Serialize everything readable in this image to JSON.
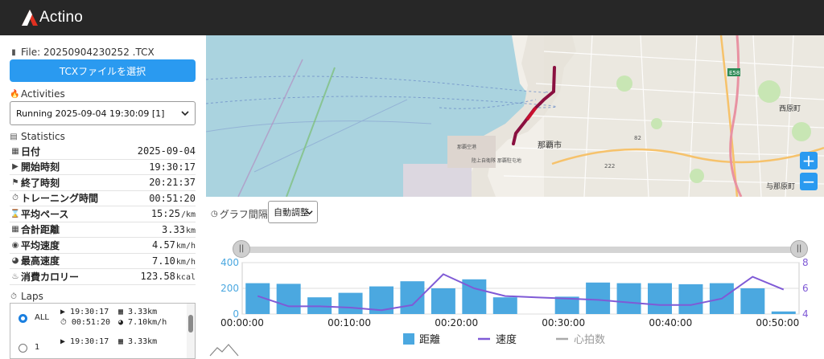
{
  "app": {
    "logo_text": "Actino"
  },
  "file": {
    "label": "File: 20250904230252 .TCX",
    "select_button": "TCXファイルを選択"
  },
  "activities": {
    "title": "Activities",
    "selected": "Running 2025-09-04 19:30:09 [1]"
  },
  "statistics": {
    "title": "Statistics",
    "rows": [
      {
        "icon": "calendar-icon",
        "label": "日付",
        "value": "2025-09-04",
        "unit": ""
      },
      {
        "icon": "play-icon",
        "label": "開始時刻",
        "value": "19:30:17",
        "unit": ""
      },
      {
        "icon": "flag-icon",
        "label": "終了時刻",
        "value": "20:21:37",
        "unit": ""
      },
      {
        "icon": "stopwatch-icon",
        "label": "トレーニング時間",
        "value": "00:51:20",
        "unit": ""
      },
      {
        "icon": "hourglass-icon",
        "label": "平均ペース",
        "value": "15:25",
        "unit": "/km"
      },
      {
        "icon": "map-icon",
        "label": "合計距離",
        "value": "3.33",
        "unit": "km"
      },
      {
        "icon": "gauge-icon",
        "label": "平均速度",
        "value": "4.57",
        "unit": "km/h"
      },
      {
        "icon": "speedometer-icon",
        "label": "最高速度",
        "value": "7.10",
        "unit": "km/h"
      },
      {
        "icon": "flame-icon",
        "label": "消費カロリー",
        "value": "123.58",
        "unit": "kcal"
      }
    ]
  },
  "laps": {
    "title": "Laps",
    "items": [
      {
        "name": "ALL",
        "start": "19:30:17",
        "duration": "00:51:20",
        "distance": "3.33km",
        "speed": "7.10km/h",
        "selected": true
      },
      {
        "name": "1",
        "start": "19:30:17",
        "duration": "",
        "distance": "3.33km",
        "speed": "",
        "selected": false
      }
    ]
  },
  "map": {
    "labels": {
      "city": "那覇市",
      "town1": "西原町",
      "town2": "与那原町",
      "route1": "那覇空港",
      "route2": "陸上自衛隊 那覇駐屯地",
      "route_sign": "E58",
      "road": "222",
      "road2": "82"
    },
    "zoom_in": "+",
    "zoom_out": "−"
  },
  "graph": {
    "interval_label": "グラフ間隔",
    "interval_value": "自動調整"
  },
  "chart_data": {
    "type": "bar",
    "x_ticks": [
      "00:00:00",
      "00:10:00",
      "00:20:00",
      "00:30:00",
      "00:40:00",
      "00:50:00"
    ],
    "y_left": {
      "ticks": [
        "0",
        "200",
        "400"
      ],
      "range": [
        0,
        400
      ]
    },
    "y_right": {
      "ticks": [
        "4",
        "6",
        "8"
      ],
      "range": [
        4,
        8
      ]
    },
    "series": [
      {
        "name": "距離",
        "kind": "bar",
        "color": "#4ba8e0",
        "values": [
          240,
          235,
          130,
          165,
          215,
          255,
          200,
          270,
          130,
          0,
          135,
          245,
          240,
          240,
          232,
          240,
          200,
          20
        ]
      },
      {
        "name": "速度",
        "kind": "line",
        "color": "#7f5ad6",
        "values": [
          5.4,
          4.6,
          4.6,
          4.5,
          4.3,
          4.7,
          7.1,
          6.0,
          5.4,
          5.3,
          5.2,
          5.1,
          4.9,
          4.7,
          4.7,
          5.2,
          6.9,
          5.9
        ]
      },
      {
        "name": "心拍数",
        "kind": "line",
        "color": "#aaaaaa",
        "values": []
      }
    ]
  }
}
